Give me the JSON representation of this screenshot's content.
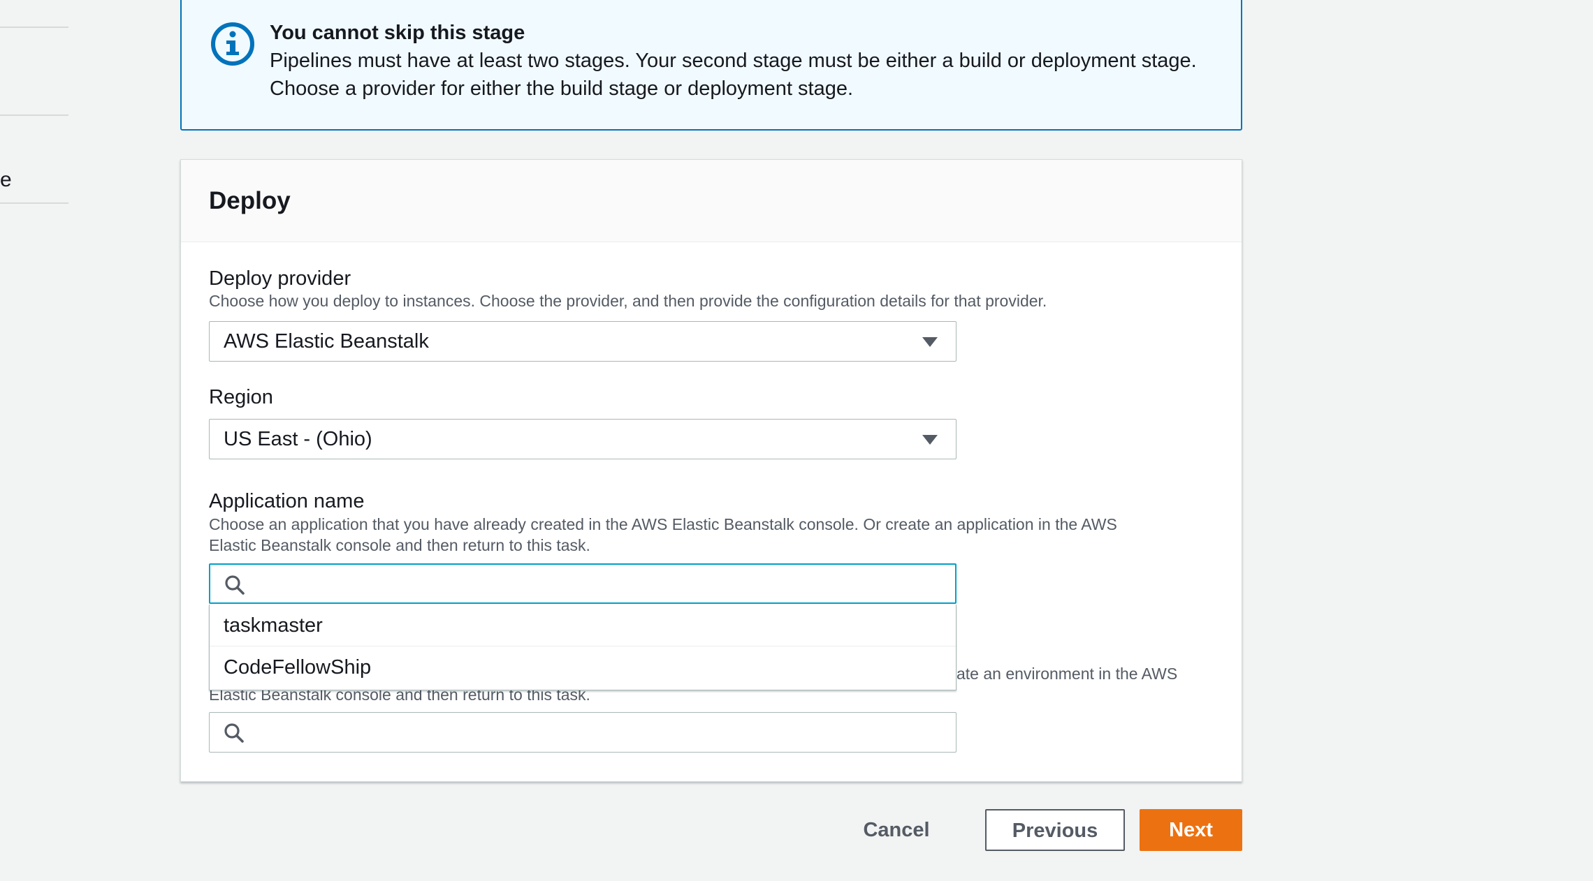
{
  "sidebar": {
    "partial_text": "e"
  },
  "alert": {
    "icon": "info-icon",
    "title": "You cannot skip this stage",
    "body_line1": "Pipelines must have at least two stages. Your second stage must be either a build or deployment stage.",
    "body_line2": "Choose a provider for either the build stage or deployment stage."
  },
  "panel": {
    "title": "Deploy",
    "deploy_provider": {
      "label": "Deploy provider",
      "description": "Choose how you deploy to instances. Choose the provider, and then provide the configuration details for that provider.",
      "value": "AWS Elastic Beanstalk"
    },
    "region": {
      "label": "Region",
      "value": "US East - (Ohio)"
    },
    "application_name": {
      "label": "Application name",
      "description_line1": "Choose an application that you have already created in the AWS Elastic Beanstalk console. Or create an application in the AWS",
      "description_line2": "Elastic Beanstalk console and then return to this task.",
      "value": "",
      "options": [
        "taskmaster",
        "CodeFellowShip"
      ]
    },
    "environment_name": {
      "description_visible_tail": "ate an environment in the AWS",
      "description_line2": "Elastic Beanstalk console and then return to this task.",
      "value": ""
    }
  },
  "footer": {
    "cancel_label": "Cancel",
    "previous_label": "Previous",
    "next_label": "Next"
  },
  "colors": {
    "accent": "#ec7211",
    "info_border": "#0073bb",
    "info_bg": "#f1faff",
    "focus": "#00a1c9"
  }
}
